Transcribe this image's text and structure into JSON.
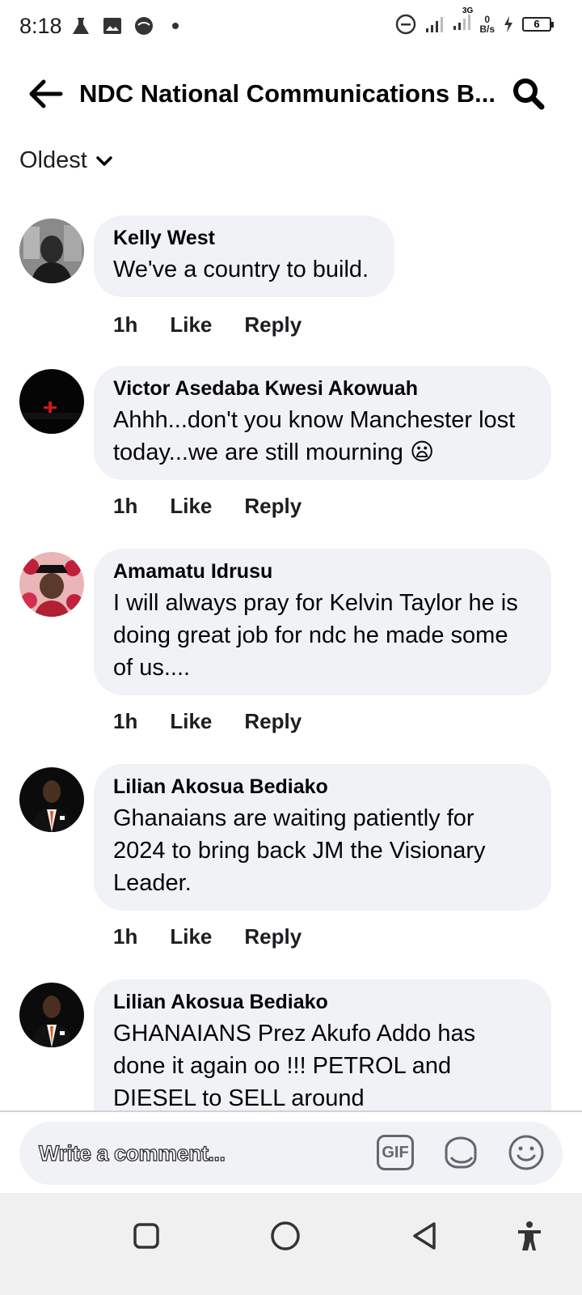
{
  "status_bar": {
    "time": "8:18",
    "network": "3G",
    "speed_value": "0",
    "speed_unit": "B/s",
    "battery": "6"
  },
  "header": {
    "title": "NDC National Communications B..."
  },
  "sort": {
    "label": "Oldest"
  },
  "comments": [
    {
      "name": "Kelly West",
      "text": "We've a country to build.",
      "time": "1h",
      "like": "Like",
      "reply": "Reply"
    },
    {
      "name": "Victor Asedaba Kwesi Akowuah",
      "text": "Ahhh...don't you know Manchester lost today...we are still mourning 😦",
      "time": "1h",
      "like": "Like",
      "reply": "Reply"
    },
    {
      "name": "Amamatu Idrusu",
      "text": "I will always pray for Kelvin Taylor he is doing great job for ndc he made some of us....",
      "time": "1h",
      "like": "Like",
      "reply": "Reply"
    },
    {
      "name": "Lilian Akosua Bediako",
      "text": "Ghanaians are waiting patiently for 2024 to bring back JM the Visionary Leader.",
      "time": "1h",
      "like": "Like",
      "reply": "Reply"
    },
    {
      "name": "Lilian Akosua Bediako",
      "text": "GHANAIANS  Prez Akufo Addo has done it again oo !!! PETROL and DIESEL to SELL around",
      "time": "",
      "like": "",
      "reply": ""
    }
  ],
  "composer": {
    "placeholder": "Write a comment...",
    "gif_label": "GIF"
  },
  "colors": {
    "bubble_bg": "#f0f2f5",
    "text": "#050505",
    "icon_grey": "#606770"
  }
}
